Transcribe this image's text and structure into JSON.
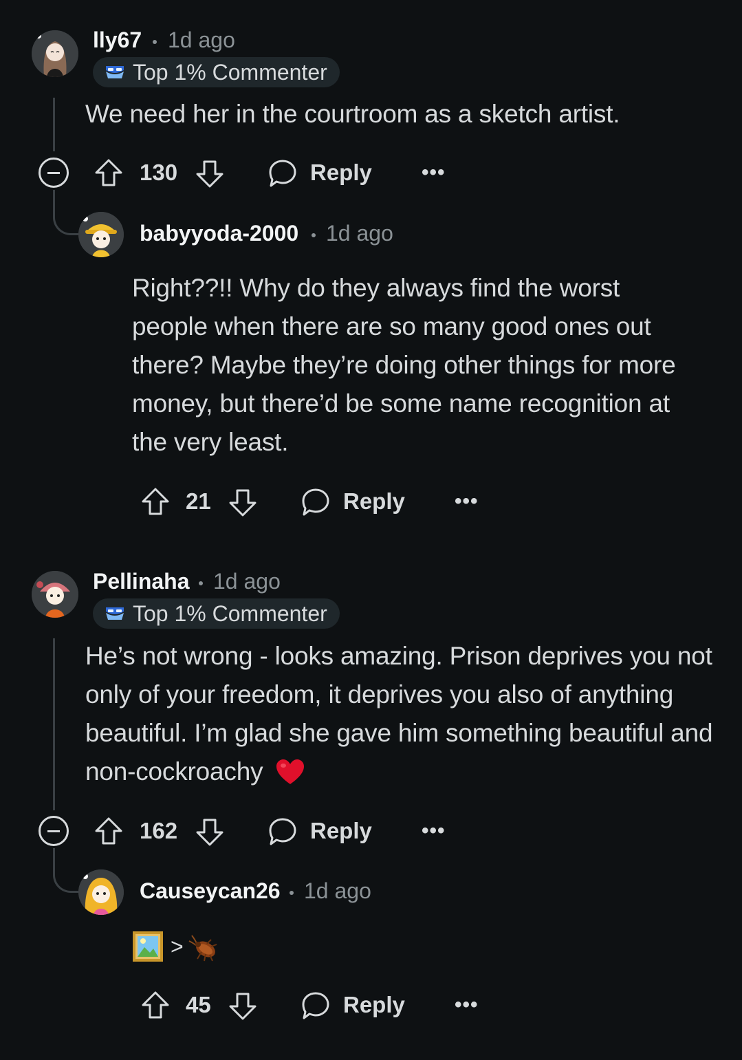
{
  "comments": [
    {
      "username": "lly67",
      "time": "1d ago",
      "badge": "Top 1% Commenter",
      "body": "We need her in the courtroom as a sketch artist.",
      "votes": "130",
      "reply_label": "Reply",
      "avatar_icon": "avatar-lly67",
      "reply": {
        "username": "babyyoda-2000",
        "time": "1d ago",
        "body": "Right??!! Why do they always find the worst people when there are so many good ones out there? Maybe they’re doing other things for more money, but there’d be some name recognition at the very least.",
        "votes": "21",
        "reply_label": "Reply",
        "avatar_icon": "avatar-babyyoda"
      }
    },
    {
      "username": "Pellinaha",
      "time": "1d ago",
      "badge": "Top 1% Commenter",
      "body": "He’s not wrong - looks amazing. Prison deprives you not only of your freedom, it deprives you also of anything beautiful. I’m glad she gave him something beautiful and non-cockroachy",
      "body_emoji": "red-heart",
      "votes": "162",
      "reply_label": "Reply",
      "avatar_icon": "avatar-pellinaha",
      "reply": {
        "username": "Causeycan26",
        "time": "1d ago",
        "body_parts": [
          "framed-picture-emoji",
          ">",
          "cockroach-emoji"
        ],
        "body_text": ">",
        "votes": "45",
        "reply_label": "Reply",
        "avatar_icon": "avatar-causeycan"
      }
    }
  ],
  "colors": {
    "background": "#0e1113",
    "text": "#d7dadc",
    "meta": "#8b9296",
    "badge_bg": "#1f272b",
    "thread_line": "#3a4044",
    "heart": "#e0102b"
  },
  "more_label": "•••"
}
